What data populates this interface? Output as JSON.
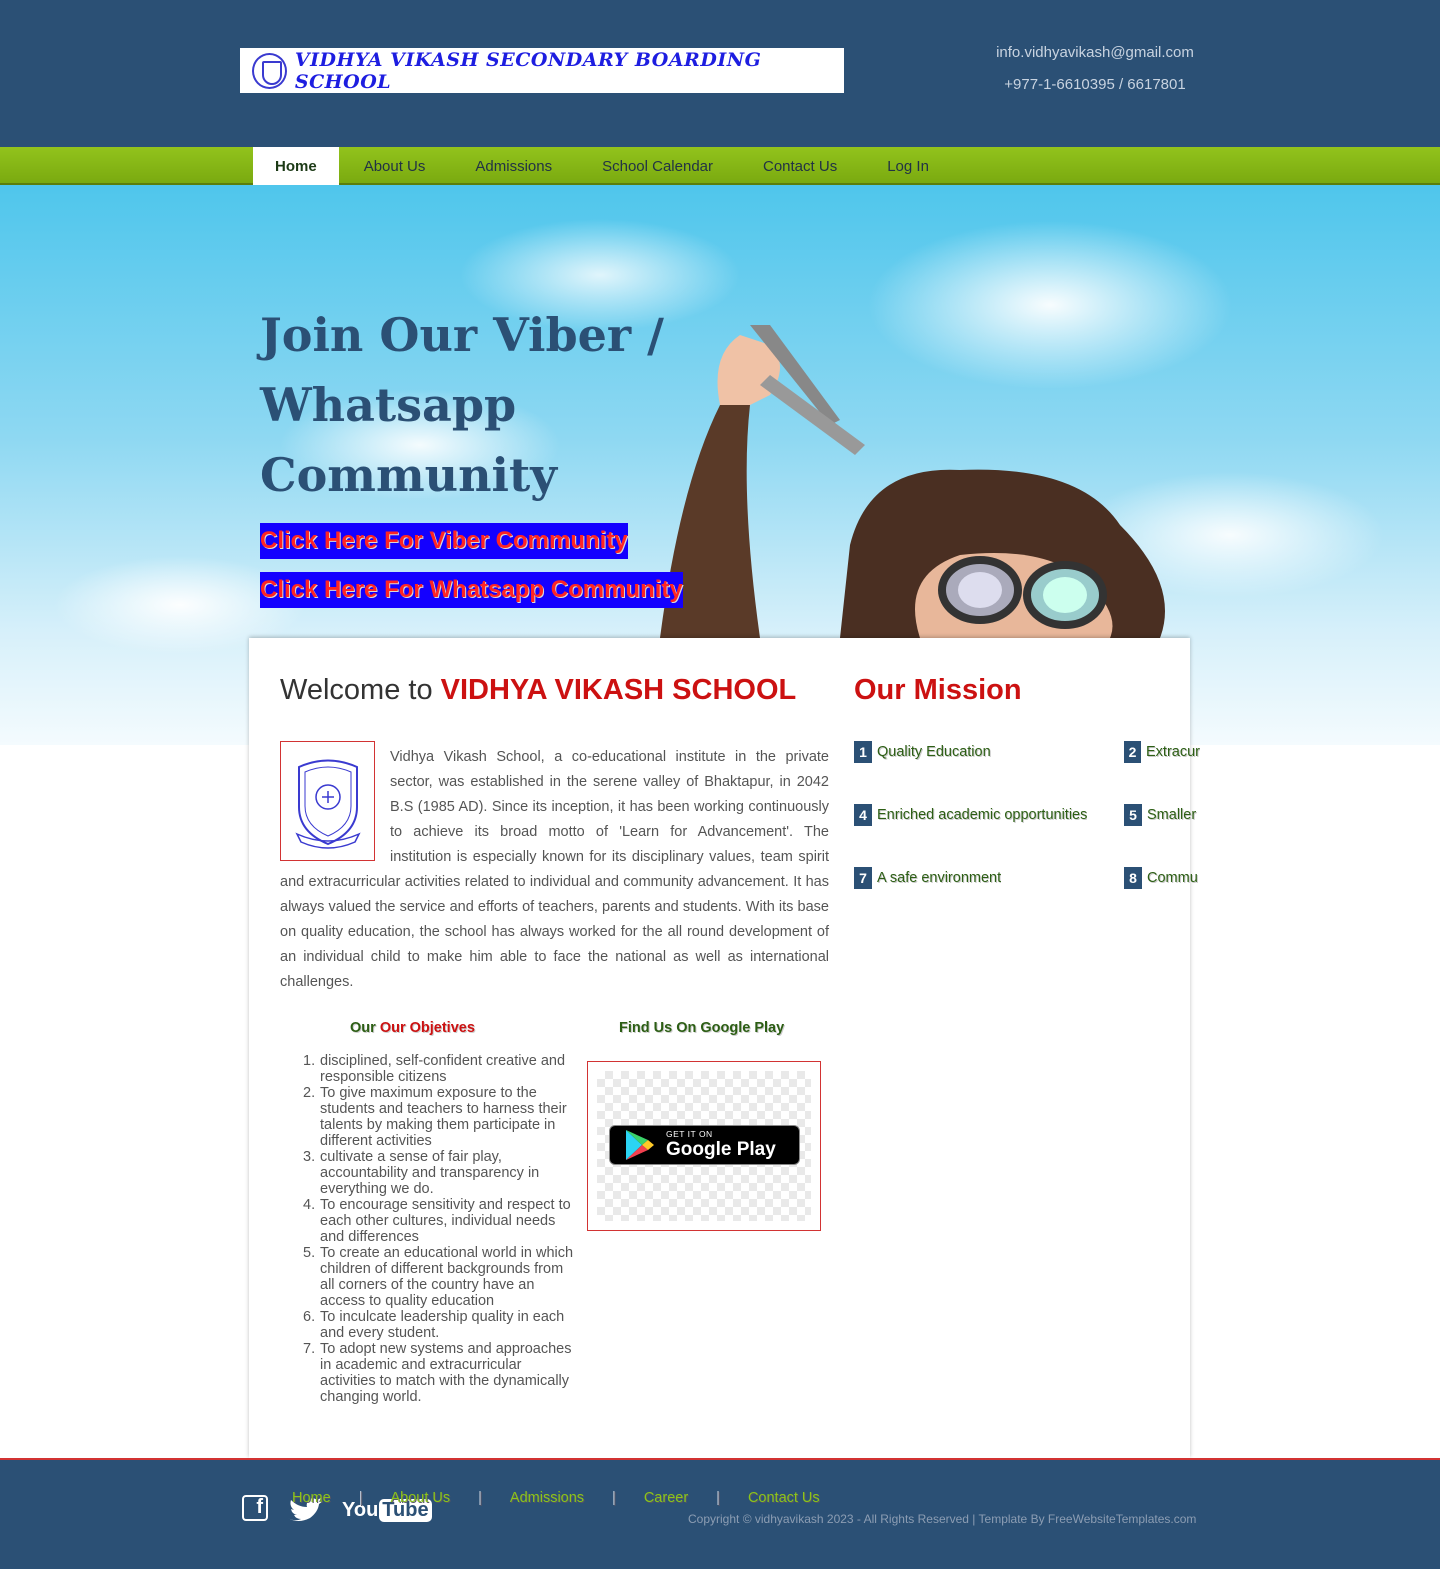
{
  "header": {
    "school_name": "VIDHYA VIKASH SECONDARY BOARDING SCHOOL",
    "email": "info.vidhyavikash@gmail.com",
    "phone": "+977-1-6610395 / 6617801"
  },
  "nav": {
    "items": [
      {
        "label": "Home",
        "active": true
      },
      {
        "label": "About Us"
      },
      {
        "label": "Admissions"
      },
      {
        "label": "School Calendar"
      },
      {
        "label": "Contact Us"
      },
      {
        "label": "Log In"
      }
    ]
  },
  "hero": {
    "title": "Join Our Viber / Whatsapp Community",
    "viber_link": "Click Here For Viber Community",
    "whatsapp_link": "Click Here For Whatsapp Community"
  },
  "welcome": {
    "prefix": "Welcome to ",
    "school": "VIDHYA VIKASH SCHOOL",
    "about": "Vidhya Vikash School, a co-educational institute in the private sector, was established in the serene valley of Bhaktapur, in 2042 B.S (1985 AD). Since its inception, it has been working continuously to achieve its broad motto of 'Learn for Advancement'. The institution is especially known for its disciplinary values, team spirit and extracurricular activities related to individual and community advancement. It has always valued the service and efforts of teachers, parents and students. With its base on quality education, the school has always worked for the all round development of an individual child to make him able to face the national as well as international challenges."
  },
  "mission": {
    "title": "Our Mission",
    "items": [
      {
        "num": "1",
        "label": "Quality Education"
      },
      {
        "num": "2",
        "label": "Extracur"
      },
      {
        "num": "4",
        "label": "Enriched academic opportunities"
      },
      {
        "num": "5",
        "label": "Smaller"
      },
      {
        "num": "7",
        "label": "A safe environment"
      },
      {
        "num": "8",
        "label": "Commu"
      }
    ]
  },
  "objectives": {
    "title_prefix": "Our ",
    "title_highlight": "Our Objetives",
    "items": [
      "disciplined, self-confident creative and responsible citizens",
      "To give maximum exposure to the students and teachers to harness their talents by making them participate in different activities",
      "cultivate a sense of fair play, accountability and transparency in everything we do.",
      "To encourage sensitivity and respect to each other cultures, individual needs and differences",
      "To create an educational world in which children of different backgrounds from all corners of the country have an access to quality education",
      "To inculcate leadership quality in each and every student.",
      "To adopt new systems and approaches in academic and extracurricular activities to match with the dynamically changing world."
    ]
  },
  "google_play": {
    "title": "Find Us On Google Play",
    "badge_small": "GET IT ON",
    "badge_big": "Google Play"
  },
  "footer": {
    "nav": [
      "Home",
      "About Us",
      "Admissions",
      "Career",
      "Contact Us"
    ],
    "separator": "|",
    "copyright": "Copyright © vidhyavikash 2023 - All Rights Reserved | Template By FreeWebsiteTemplates.com",
    "facebook_letter": "f",
    "youtube_you": "You",
    "youtube_tube": "Tube"
  },
  "colors": {
    "header_bg": "#2b5075",
    "nav_green": "#8bc519",
    "accent_red": "#cc1111",
    "link_blue_bg": "#1400ff"
  },
  "icons": [
    "school-crest-icon",
    "facebook-icon",
    "twitter-icon",
    "youtube-icon",
    "google-play-icon"
  ]
}
